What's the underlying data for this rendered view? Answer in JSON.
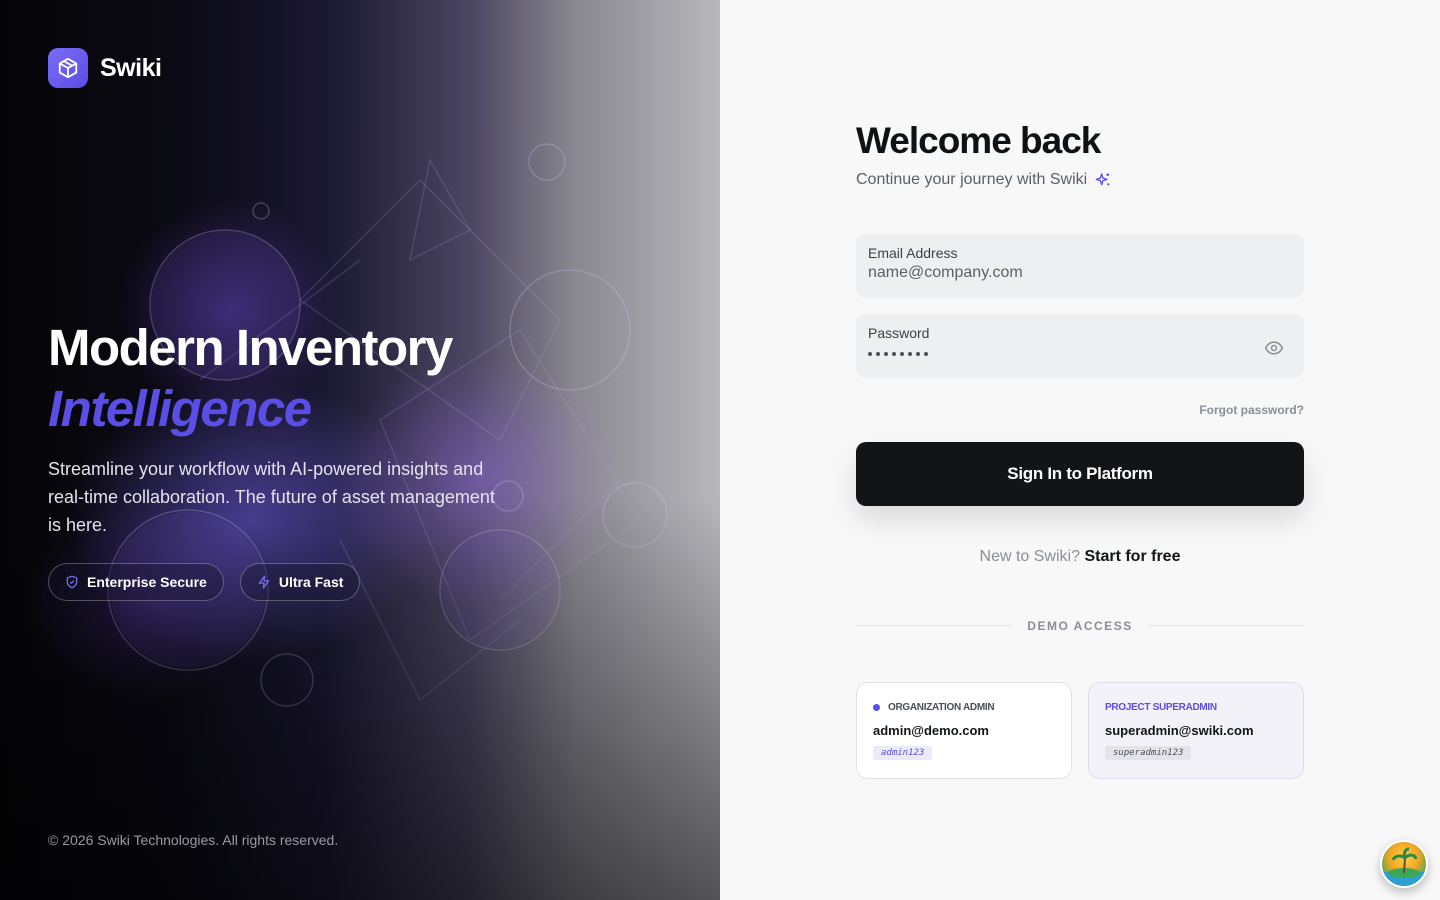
{
  "brand": {
    "name": "Swiki"
  },
  "hero": {
    "title": "Modern Inventory",
    "accent": "Intelligence",
    "description": "Streamline your workflow with AI-powered insights and real-time collaboration. The future of asset management is here.",
    "pills": [
      {
        "label": "Enterprise Secure",
        "icon": "shield-icon"
      },
      {
        "label": "Ultra Fast",
        "icon": "lightning-icon"
      }
    ],
    "copyright": "© 2026 Swiki Technologies. All rights reserved."
  },
  "form": {
    "heading": "Welcome back",
    "subheading": "Continue your journey with Swiki",
    "email": {
      "label": "Email Address",
      "placeholder": "name@company.com",
      "value": ""
    },
    "password": {
      "label": "Password",
      "masked": "••••••••"
    },
    "forgot": "Forgot password?",
    "submit": "Sign In to Platform",
    "signup_prompt": "New to Swiki?",
    "signup_link": "Start for free",
    "demo_label": "DEMO ACCESS",
    "demos": [
      {
        "role": "ORGANIZATION ADMIN",
        "email": "admin@demo.com",
        "password": "admin123"
      },
      {
        "role": "PROJECT SUPERADMIN",
        "email": "superadmin@swiki.com",
        "password": "superadmin123"
      }
    ]
  },
  "colors": {
    "accent": "#5b4ee6",
    "button": "#121517",
    "panel": "#f8f8f9"
  }
}
